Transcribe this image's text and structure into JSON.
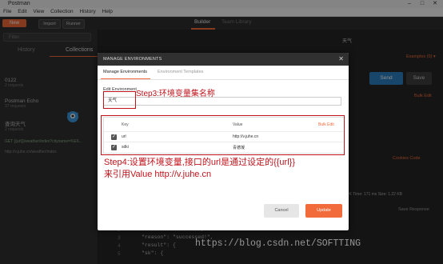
{
  "window": {
    "app_title": "Postman",
    "minimize": "–",
    "maximize": "□",
    "close": "✕"
  },
  "menu": [
    "File",
    "Edit",
    "View",
    "Collection",
    "History",
    "Help"
  ],
  "header": {
    "new_label": "New",
    "import_label": "Import",
    "runner_label": "Runner",
    "builder_label": "Builder",
    "team_library_label": "Team Library"
  },
  "sidebar": {
    "filter_placeholder": "Filter",
    "tabs": [
      "History",
      "Collections"
    ],
    "items": [
      {
        "title": "0122",
        "sub": "2 requests"
      },
      {
        "title": "Postman Echo",
        "sub": "37 requests"
      },
      {
        "title": "查询天气",
        "sub": "2 requests"
      }
    ],
    "history_1": "GET  {{url}}/weather/index?cityname=%E6...",
    "history_2": "http://v.juhe.cn/weather/index"
  },
  "main": {
    "env_select": "天气",
    "examples": "Examples (0) ▾",
    "send_label": "Send",
    "save_label": "Save",
    "bulk_edit": "Bulk Edit",
    "cookies": "Cookies  Code",
    "status": "Status: 200 OK   Time: 171 ms   Size: 1.22 KB",
    "save_response": "Save Response",
    "code_lines": [
      {
        "n": "2",
        "text": "\"resultcode\": \"200\","
      },
      {
        "n": "3",
        "text": "\"reason\": \"successed!\","
      },
      {
        "n": "4",
        "text": "\"result\": {"
      },
      {
        "n": "5",
        "text": "    \"sk\": {"
      }
    ]
  },
  "modal": {
    "title": "MANAGE ENVIRONMENTS",
    "tab_active": "Manage Environments",
    "tab_inactive": "Environment Templates",
    "edit_label": "Edit Environment",
    "env_name": "天气",
    "col_key": "Key",
    "col_value": "Value",
    "bulk_edit": "Bulk Edit",
    "rows": [
      {
        "key": "url",
        "value": "http://v.juhe.cn"
      },
      {
        "key": "sdki",
        "value": "青德凝"
      }
    ],
    "cancel_label": "Cancel",
    "update_label": "Update"
  },
  "annotations": {
    "step3": "Step3:环境变量集名称",
    "step4_line1": "Step4:设置环境变量,接口的url是通过设定的{{url}}",
    "step4_line2": "来引用Value http://v.juhe.cn"
  },
  "watermark": "https://blog.csdn.net/SOFTTING",
  "colors": {
    "accent": "#f26b3a",
    "annotation_red": "#c0131b",
    "dark_bg": "#2b2b2b"
  }
}
